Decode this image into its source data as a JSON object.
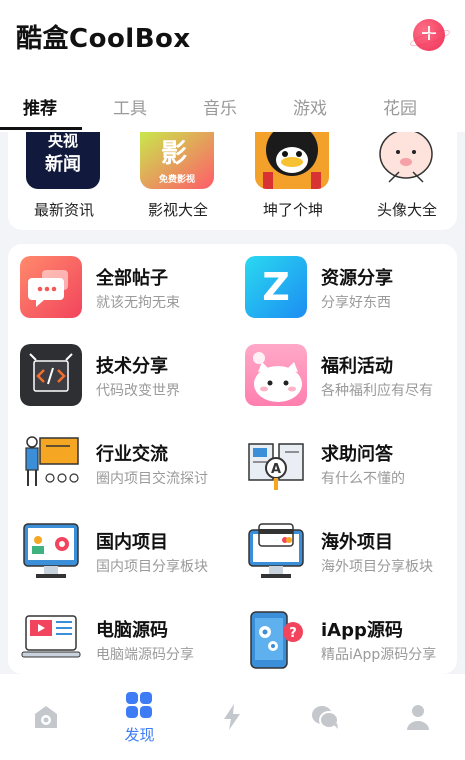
{
  "app": {
    "title": "酷盒CoolBox",
    "add_icon": "plus-icon"
  },
  "tabs": [
    {
      "label": "推荐",
      "active": true
    },
    {
      "label": "工具",
      "active": false
    },
    {
      "label": "音乐",
      "active": false
    },
    {
      "label": "游戏",
      "active": false
    },
    {
      "label": "花园",
      "active": false
    }
  ],
  "quick": [
    {
      "label": "最新资讯",
      "icon_text": "央视\n新闻"
    },
    {
      "label": "影视大全",
      "icon_text": "影",
      "icon_sub": "免费影视"
    },
    {
      "label": "坤了个坤"
    },
    {
      "label": "头像大全"
    }
  ],
  "entries": [
    {
      "title": "全部帖子",
      "sub": "就该无拘无束"
    },
    {
      "title": "资源分享",
      "sub": "分享好东西",
      "icon_text": "Z"
    },
    {
      "title": "技术分享",
      "sub": "代码改变世界"
    },
    {
      "title": "福利活动",
      "sub": "各种福利应有尽有"
    },
    {
      "title": "行业交流",
      "sub": "圈内项目交流探讨"
    },
    {
      "title": "求助问答",
      "sub": "有什么不懂的"
    },
    {
      "title": "国内项目",
      "sub": "国内项目分享板块"
    },
    {
      "title": "海外项目",
      "sub": "海外项目分享板块"
    },
    {
      "title": "电脑源码",
      "sub": "电脑端源码分享"
    },
    {
      "title": "iApp源码",
      "sub": "精品iApp源码分享"
    }
  ],
  "nav": [
    {
      "icon": "home-icon"
    },
    {
      "icon": "discover-icon",
      "label": "发现",
      "active": true
    },
    {
      "icon": "lightning-icon"
    },
    {
      "icon": "chat-icon"
    },
    {
      "icon": "user-icon"
    }
  ],
  "colors": {
    "accent": "#3d7cf5",
    "add_button": "#ef3158",
    "muted": "#9a9a9a"
  }
}
